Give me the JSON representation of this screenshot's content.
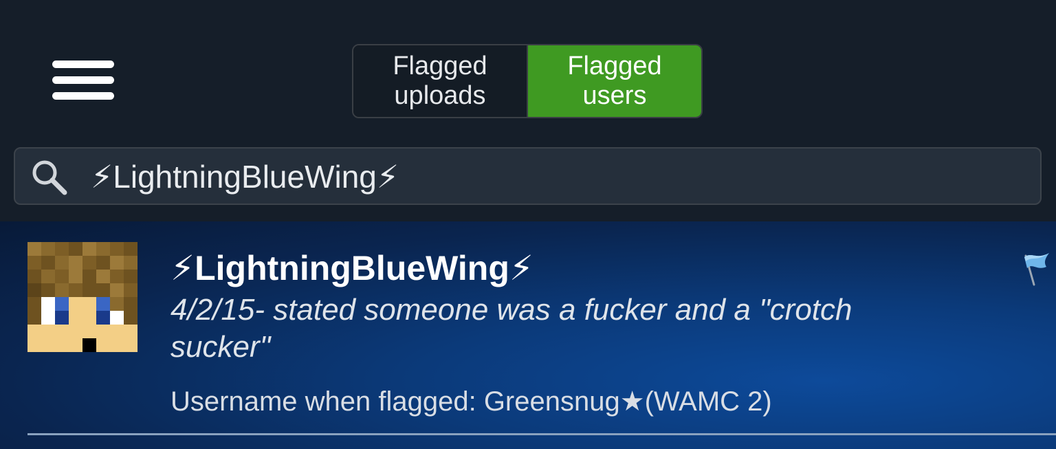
{
  "header": {
    "menu_icon": "hamburger-icon",
    "segments": [
      {
        "label": "Flagged\nuploads",
        "active": false
      },
      {
        "label": "Flagged\nusers",
        "active": true
      }
    ]
  },
  "search": {
    "icon": "search-icon",
    "value": "⚡LightningBlueWing⚡"
  },
  "results": [
    {
      "username": "⚡LightningBlueWing⚡",
      "note": "4/2/15- stated someone was a fucker and a \"crotch sucker\"",
      "flagged_as": "Username when flagged: Greensnug★(WAMC 2)",
      "flag_icon": "flag-icon"
    }
  ],
  "colors": {
    "active_segment": "#3f9a22",
    "background": "#151e29",
    "search_bg": "#252f3b",
    "result_bg": "#0b3a7a"
  }
}
